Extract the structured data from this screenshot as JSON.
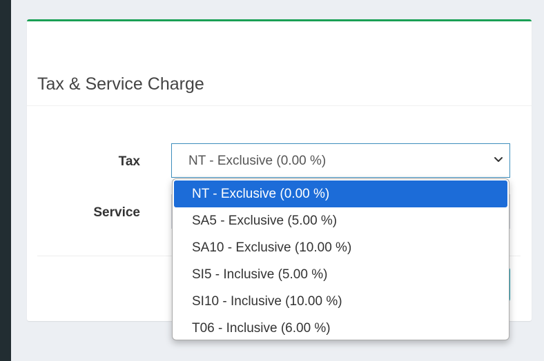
{
  "card": {
    "title": "Tax & Service Charge",
    "accent_color": "#1aa055"
  },
  "form": {
    "tax_label": "Tax",
    "service_label": "Service",
    "tax_select": {
      "selected_value": "NT - Exclusive (0.00 %)",
      "options": [
        "NT - Exclusive (0.00 %)",
        "SA5 - Exclusive (5.00 %)",
        "SA10 - Exclusive (10.00 %)",
        "SI5 - Inclusive (5.00 %)",
        "SI10 - Inclusive (10.00 %)",
        "T06 - Inclusive (6.00 %)"
      ],
      "highlight_color": "#1c6cd8"
    }
  },
  "icons": {
    "dropdown": "chevron-down-icon"
  }
}
